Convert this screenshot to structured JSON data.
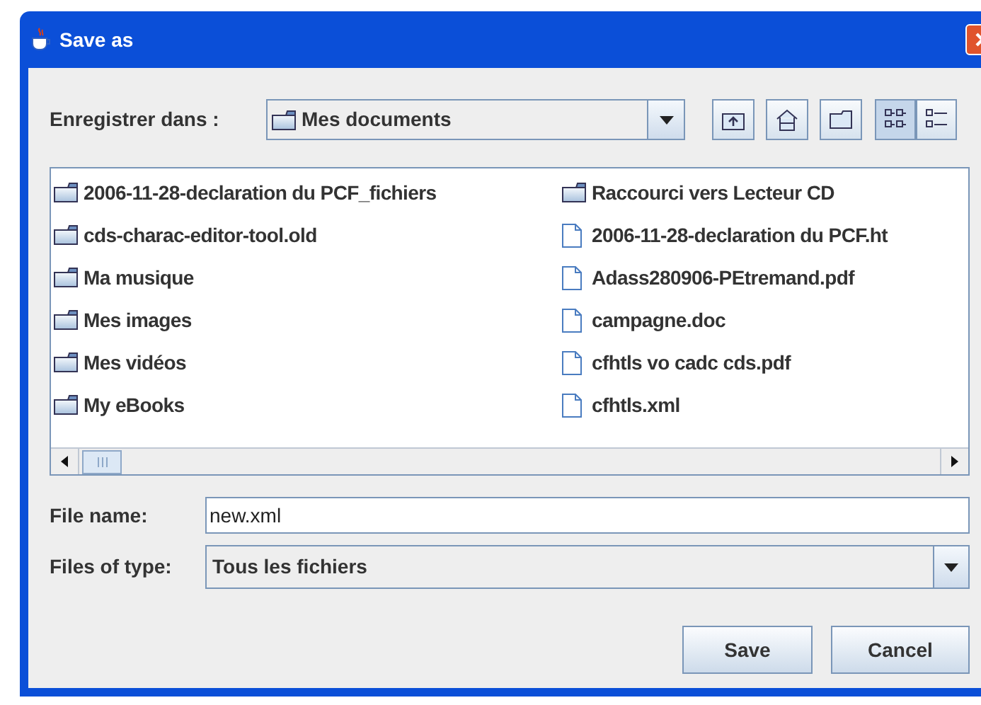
{
  "window": {
    "title": "Save as"
  },
  "look_in": {
    "label": "Enregistrer dans :",
    "value": "Mes documents"
  },
  "view_modes": [
    {
      "kind": "list",
      "selected": true
    },
    {
      "kind": "details",
      "selected": false
    }
  ],
  "files": {
    "columns": [
      [
        {
          "kind": "folder",
          "name": "2006-11-28-declaration du PCF_fichiers"
        },
        {
          "kind": "folder",
          "name": "cds-charac-editor-tool.old"
        },
        {
          "kind": "folder",
          "name": "Ma musique"
        },
        {
          "kind": "folder",
          "name": "Mes images"
        },
        {
          "kind": "folder",
          "name": "Mes vidéos"
        },
        {
          "kind": "folder",
          "name": "My eBooks"
        }
      ],
      [
        {
          "kind": "folder",
          "name": "Raccourci vers Lecteur CD"
        },
        {
          "kind": "file",
          "name": "2006-11-28-declaration du PCF.ht"
        },
        {
          "kind": "file",
          "name": "Adass280906-PEtremand.pdf"
        },
        {
          "kind": "file",
          "name": "campagne.doc"
        },
        {
          "kind": "file",
          "name": "cfhtls vo cadc cds.pdf"
        },
        {
          "kind": "file",
          "name": "cfhtls.xml"
        }
      ]
    ]
  },
  "file_name": {
    "label": "File name:",
    "value": "new.xml"
  },
  "file_type": {
    "label": "Files of type:",
    "value": "Tous les fichiers"
  },
  "buttons": [
    "Save",
    "Cancel"
  ]
}
